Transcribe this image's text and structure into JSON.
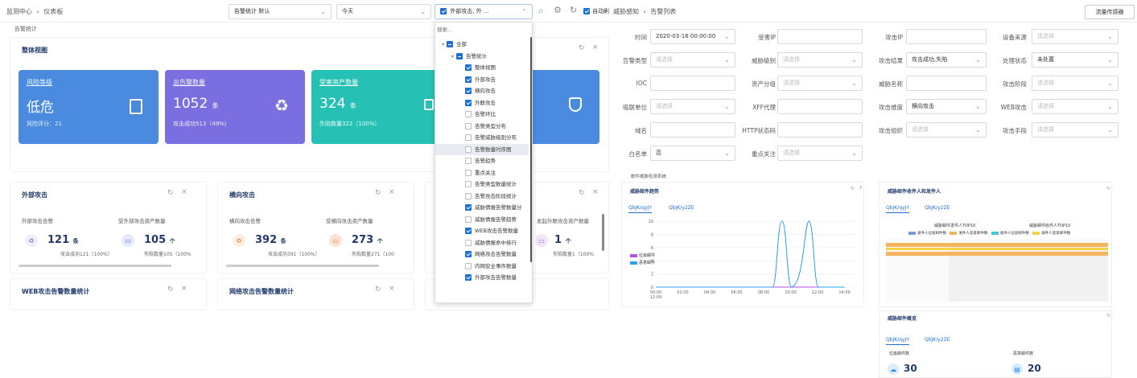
{
  "breadcrumb": {
    "root": "监测中心",
    "sep": "›",
    "current": "仪表板"
  },
  "toolbar": {
    "template_select": "告警统计 默认",
    "time_select": "今天",
    "filter_select": "外部攻击, 外 ...",
    "auto_label": "自动刷"
  },
  "page_label": "告警统计",
  "dropdown": {
    "search_placeholder": "搜索...",
    "items": [
      {
        "label": "全部",
        "state": "ind",
        "level": 0
      },
      {
        "label": "告警统计",
        "state": "ind",
        "level": 1
      },
      {
        "label": "整体视图",
        "state": "on",
        "level": 2
      },
      {
        "label": "外部攻击",
        "state": "on",
        "level": 2
      },
      {
        "label": "横向攻击",
        "state": "on",
        "level": 2
      },
      {
        "label": "外联攻击",
        "state": "on",
        "level": 2
      },
      {
        "label": "告警环比",
        "state": "off",
        "level": 2
      },
      {
        "label": "告警类型分布",
        "state": "off",
        "level": 2
      },
      {
        "label": "告警威胁级别分布",
        "state": "off",
        "level": 2
      },
      {
        "label": "告警数量时序图",
        "state": "off",
        "level": 2
      },
      {
        "label": "告警趋势",
        "state": "off",
        "level": 2
      },
      {
        "label": "重点关注",
        "state": "off",
        "level": 2
      },
      {
        "label": "告警类型数量统计",
        "state": "off",
        "level": 2
      },
      {
        "label": "告警攻击阶段统计",
        "state": "off",
        "level": 2
      },
      {
        "label": "威胁情报告警数量分",
        "state": "on",
        "level": 2
      },
      {
        "label": "威胁情报告警趋势",
        "state": "off",
        "level": 2
      },
      {
        "label": "WEB攻击告警数量",
        "state": "on",
        "level": 2
      },
      {
        "label": "威胁情报命中排行",
        "state": "off",
        "level": 2
      },
      {
        "label": "网络攻击告警数量",
        "state": "on",
        "level": 2
      },
      {
        "label": "内网安全事件数量",
        "state": "off",
        "level": 2
      },
      {
        "label": "外部攻击告警数量",
        "state": "on",
        "level": 2
      }
    ]
  },
  "overview": {
    "title": "整体视图",
    "cards": [
      {
        "title": "风险等级",
        "value": "低危",
        "unit": "",
        "sub": "风险评分：21",
        "color": "#4a8be0"
      },
      {
        "title": "总告警数量",
        "value": "1052",
        "unit": "条",
        "sub": "攻击成功513（49%）",
        "color": "#7b6ee0"
      },
      {
        "title": "受害资产数量",
        "value": "324",
        "unit": "条",
        "sub": "失陷数量322（100%）",
        "color": "#27c0b4"
      },
      {
        "title": "",
        "value": "",
        "unit": "",
        "sub": "",
        "color": "#4a8be0"
      }
    ]
  },
  "external": {
    "title": "外部攻击",
    "a_label": "外部攻击告警",
    "a_value": "121",
    "a_unit": "条",
    "a_sub": "攻击成功121（100%）",
    "b_label": "受外部攻击资产数量",
    "b_value": "105",
    "b_unit": "个",
    "b_sub": "失陷数量105（100%"
  },
  "lateral": {
    "title": "横向攻击",
    "a_label": "横向攻击告警",
    "a_value": "392",
    "a_unit": "条",
    "a_sub": "攻击成功391（100%）",
    "b_label": "受横向攻击资产数量",
    "b_value": "273",
    "b_unit": "个",
    "b_sub": "失陷数量271（100"
  },
  "outbound": {
    "b_label": "发起外联攻击资产数量",
    "b_value": "1",
    "b_unit": "个",
    "b_sub": "失陷数量1（100%"
  },
  "web_title": "WEB攻击告警数量统计",
  "net_title": "网络攻击告警数量统计",
  "right": {
    "breadcrumb": {
      "root": "威胁感知",
      "sep": "›",
      "current": "告警列表"
    },
    "sensor_button": "流量传感器",
    "filters": [
      {
        "label": "时间",
        "value": "2020-03-16 00:00:00",
        "has": true,
        "kind": "select"
      },
      {
        "label": "受害IP",
        "value": "",
        "has": false,
        "kind": "input"
      },
      {
        "label": "攻击IP",
        "value": "",
        "has": false,
        "kind": "input"
      },
      {
        "label": "设备来源",
        "value": "请选择",
        "has": false,
        "kind": "select"
      },
      {
        "label": "告警类型",
        "value": "请选择",
        "has": false,
        "kind": "select"
      },
      {
        "label": "威胁级别",
        "value": "请选择",
        "has": false,
        "kind": "select"
      },
      {
        "label": "攻击结果",
        "value": "攻击成功,失陷",
        "has": true,
        "kind": "select"
      },
      {
        "label": "处理状态",
        "value": "未处置",
        "has": true,
        "kind": "select"
      },
      {
        "label": "IOC",
        "value": "",
        "has": false,
        "kind": "input"
      },
      {
        "label": "资产分组",
        "value": "请选择",
        "has": false,
        "kind": "select"
      },
      {
        "label": "威胁名称",
        "value": "",
        "has": false,
        "kind": "input"
      },
      {
        "label": "攻击阶段",
        "value": "请选择",
        "has": false,
        "kind": "select"
      },
      {
        "label": "吸联单位",
        "value": "请选择",
        "has": false,
        "kind": "select"
      },
      {
        "label": "XFF代理",
        "value": "",
        "has": false,
        "kind": "input"
      },
      {
        "label": "攻击维度",
        "value": "横向攻击",
        "has": true,
        "kind": "select"
      },
      {
        "label": "WEB攻击",
        "value": "请选择",
        "has": false,
        "kind": "select"
      },
      {
        "label": "域名",
        "value": "",
        "has": false,
        "kind": "input"
      },
      {
        "label": "HTTP状态码",
        "value": "",
        "has": false,
        "kind": "input"
      },
      {
        "label": "攻击组织",
        "value": "请选择",
        "has": false,
        "kind": "select"
      },
      {
        "label": "攻击手段",
        "value": "请选择",
        "has": false,
        "kind": "select"
      },
      {
        "label": "白名单",
        "value": "否",
        "has": true,
        "kind": "select"
      },
      {
        "label": "重点关注",
        "value": "请选择",
        "has": false,
        "kind": "select"
      }
    ],
    "section_caption": "邮件威胁检测系统",
    "trend": {
      "title": "威胁邮件趋势",
      "tab1": "QbJK/qyJY",
      "tab2": "QbJK/y2ZE",
      "legend": [
        "垃圾邮件",
        "恶意邮件"
      ],
      "legend_colors": [
        "#b44fe0",
        "#2aa0e8"
      ]
    },
    "top10": {
      "title": "威胁邮件收件人和发件人",
      "tab1": "QbJK/qyJY",
      "tab2": "QbJK/y2ZE",
      "sub1": "威胁邮件发件人TOP10",
      "sub2": "威胁邮件收件人TOP10",
      "legend": [
        "发件人垃圾邮件数",
        "发件人恶意邮件数",
        "收件人垃圾邮件数",
        "收件人恶意邮件数"
      ],
      "legend_colors": [
        "#7a9ae0",
        "#f2b45c",
        "#49c3d8",
        "#f5d04a"
      ]
    },
    "overview2": {
      "title": "威胁邮件概览",
      "tab1": "QbJK/qyJY",
      "tab2": "QbJK/y2ZE",
      "a_label": "垃圾邮件数",
      "a_value": "30",
      "b_label": "恶意邮件数",
      "b_value": "20"
    }
  },
  "chart_data": {
    "type": "line",
    "x": [
      "00:00\n12:09",
      "02:00",
      "04:00",
      "06:00",
      "08:00",
      "10:00",
      "12:00",
      "14:00"
    ],
    "ylim": [
      0,
      10
    ],
    "yticks": [
      0,
      2,
      4,
      6,
      8,
      10
    ],
    "series": [
      {
        "name": "垃圾邮件",
        "values": [
          0,
          0,
          0,
          0,
          0,
          0,
          0,
          0
        ]
      },
      {
        "name": "恶意邮件",
        "values": [
          0,
          0,
          0,
          0,
          0,
          10,
          10,
          0
        ]
      }
    ]
  },
  "icons": {
    "close": "×",
    "refresh": "↻",
    "gear": "⚙",
    "search": "⌕"
  }
}
